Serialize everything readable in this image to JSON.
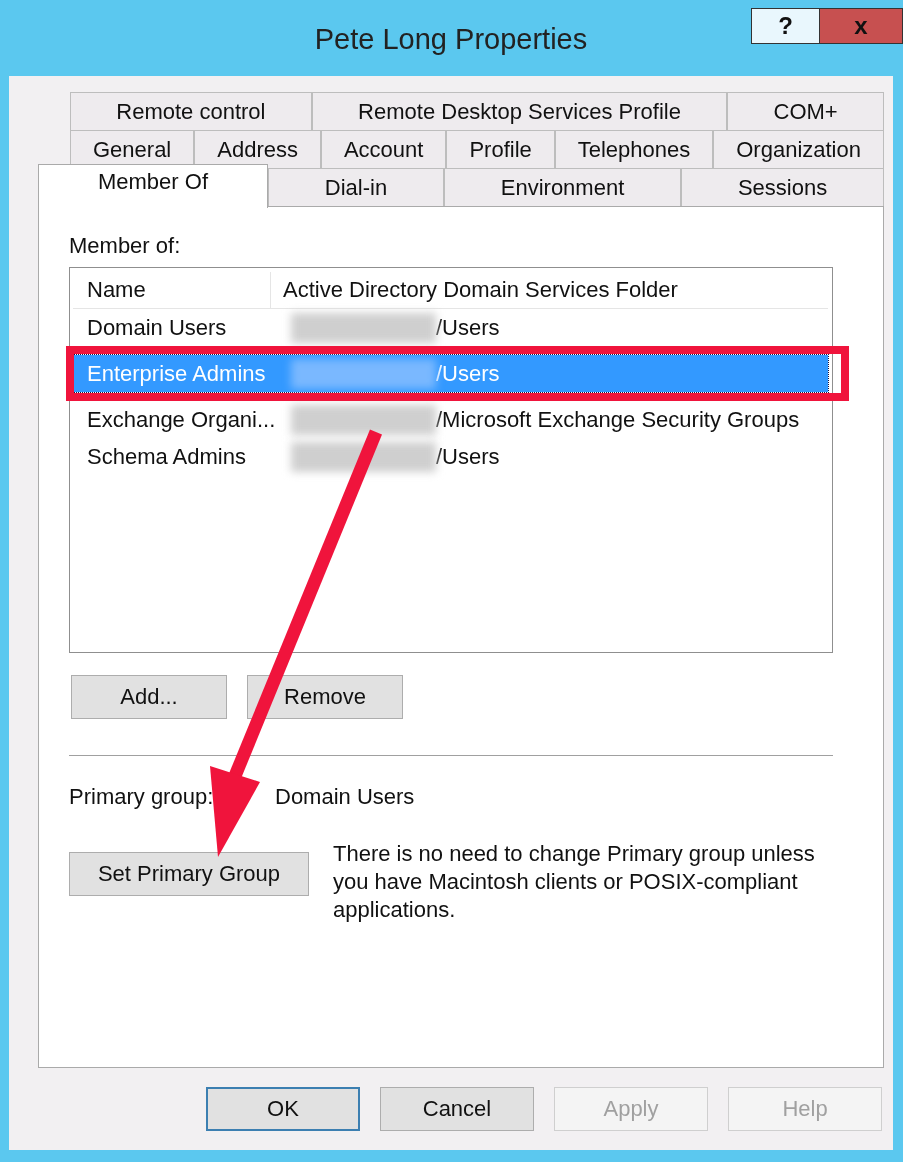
{
  "window": {
    "title": "Pete Long Properties",
    "help_button": "?",
    "close_button": "x"
  },
  "tab_rows": [
    [
      {
        "label": "Remote control",
        "selected": false
      },
      {
        "label": "Remote Desktop Services Profile",
        "selected": false
      },
      {
        "label": "COM+",
        "selected": false
      }
    ],
    [
      {
        "label": "General",
        "selected": false
      },
      {
        "label": "Address",
        "selected": false
      },
      {
        "label": "Account",
        "selected": false
      },
      {
        "label": "Profile",
        "selected": false
      },
      {
        "label": "Telephones",
        "selected": false
      },
      {
        "label": "Organization",
        "selected": false
      }
    ],
    [
      {
        "label": "Member Of",
        "selected": true
      },
      {
        "label": "Dial-in",
        "selected": false
      },
      {
        "label": "Environment",
        "selected": false
      },
      {
        "label": "Sessions",
        "selected": false
      }
    ]
  ],
  "member_of": {
    "label": "Member of:",
    "columns": [
      "Name",
      "Active Directory Domain Services Folder"
    ],
    "rows": [
      {
        "name": "Domain Users",
        "folder": "/Users",
        "selected": false
      },
      {
        "name": "Enterprise Admins",
        "folder": "/Users",
        "selected": true
      },
      {
        "name": "Exchange Organi...",
        "folder": "/Microsoft Exchange Security Groups",
        "selected": false
      },
      {
        "name": "Schema Admins",
        "folder": "/Users",
        "selected": false
      }
    ],
    "buttons": [
      "Add...",
      "Remove"
    ]
  },
  "primary_group": {
    "label": "Primary group:",
    "value": "Domain Users",
    "button": "Set Primary Group",
    "note": "There is no need to change Primary group unless you have Macintosh clients or POSIX-compliant applications."
  },
  "dialog_buttons": [
    {
      "label": "OK",
      "default": true,
      "disabled": false
    },
    {
      "label": "Cancel",
      "default": false,
      "disabled": false
    },
    {
      "label": "Apply",
      "default": false,
      "disabled": true
    },
    {
      "label": "Help",
      "default": false,
      "disabled": true
    }
  ]
}
